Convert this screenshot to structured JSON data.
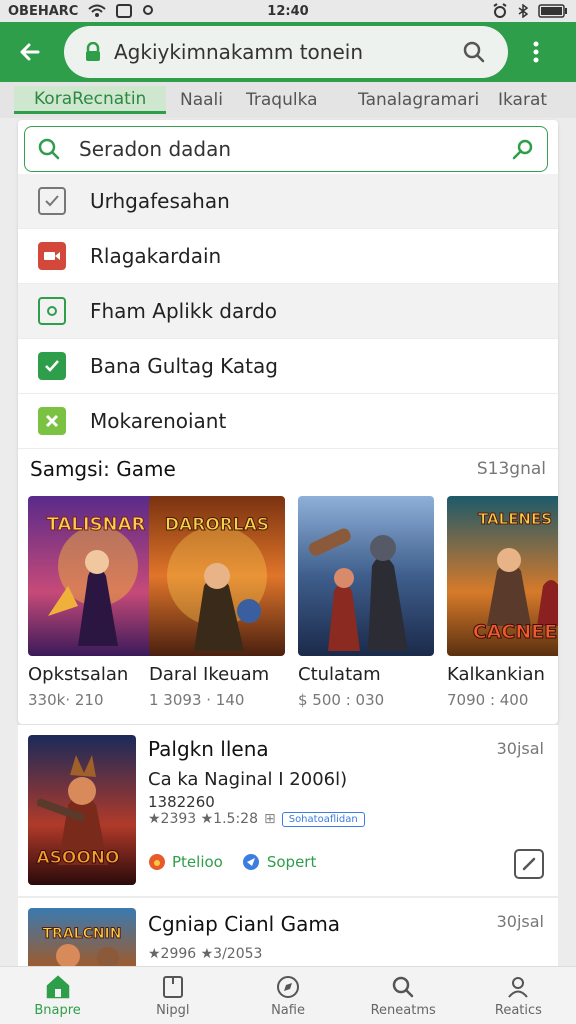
{
  "status_bar": {
    "carrier": "OBEHARC",
    "time": "12:40"
  },
  "app_bar": {
    "url": "Agkiykimnakamm tonein"
  },
  "tabs": [
    {
      "label": "KoraRecnatin",
      "active": true
    },
    {
      "label": "Naali",
      "active": false
    },
    {
      "label": "Traqulka",
      "active": false
    },
    {
      "label": "Tanalagramari",
      "active": false
    },
    {
      "label": "Ikarat",
      "active": false
    }
  ],
  "search": {
    "value": "Seradon dadan"
  },
  "menu": [
    {
      "label": "Urhgafesahan",
      "icon": "checkbox-icon",
      "color": "#777777"
    },
    {
      "label": "Rlagakardain",
      "icon": "video-icon",
      "color": "#d2483a"
    },
    {
      "label": "Fham Aplikk dardo",
      "icon": "app-icon",
      "color": "#2f9e4a"
    },
    {
      "label": "Bana Gultag Katag",
      "icon": "check-icon",
      "color": "#2f9e4a"
    },
    {
      "label": "Mokarenoiant",
      "icon": "puzzle-icon",
      "color": "#7cc242"
    }
  ],
  "section": {
    "title": "Samgsi: Game",
    "link": "S13gnal"
  },
  "games": [
    {
      "name": "Opkstsalan",
      "meta": "330k· 210",
      "cover_title": "TALISNAR",
      "palette": [
        "#5a2a8a",
        "#c64a78",
        "#f0b13a"
      ]
    },
    {
      "name": "Daral Ikeuam",
      "meta": "1 3093 · 140",
      "cover_title": "DARORLAS",
      "palette": [
        "#7a3210",
        "#e0752a",
        "#f7c34a"
      ]
    },
    {
      "name": "Ctulatam",
      "meta": "$ 500 : 030",
      "cover_title": "",
      "palette": [
        "#1b2a4a",
        "#3f5e8c",
        "#8fb0d8"
      ]
    },
    {
      "name": "Kalkankian",
      "meta": "7090 : 400",
      "cover_title": "CACNEE",
      "palette": [
        "#1d5a6a",
        "#d67a2a",
        "#f5c84a"
      ]
    }
  ],
  "feature": {
    "title": "Palgkn llena",
    "age": "30jsal",
    "subtitle": "Ca ka Naginal I 2006l)",
    "count": "1382260",
    "rating_text": "★2393 ★1.5:28",
    "badge": "Sohatoaflidan",
    "action1": "Ptelioo",
    "action2": "Sopert",
    "cover_title": "ASOONO"
  },
  "feature2": {
    "title": "Cgniap Cianl Gama",
    "age": "30jsal",
    "rating_text": "★2996 ★3/2053",
    "cover_title": "TRALCNIN"
  },
  "bottom_nav": [
    {
      "label": "Bnapre",
      "icon": "home-icon",
      "active": true
    },
    {
      "label": "Nipgl",
      "icon": "bookmark-icon",
      "active": false
    },
    {
      "label": "Nafie",
      "icon": "compass-icon",
      "active": false
    },
    {
      "label": "Reneatms",
      "icon": "search-icon",
      "active": false
    },
    {
      "label": "Reatics",
      "icon": "person-icon",
      "active": false
    }
  ],
  "colors": {
    "brand_green": "#2f9e4a",
    "accent_blue": "#3b7de0"
  }
}
